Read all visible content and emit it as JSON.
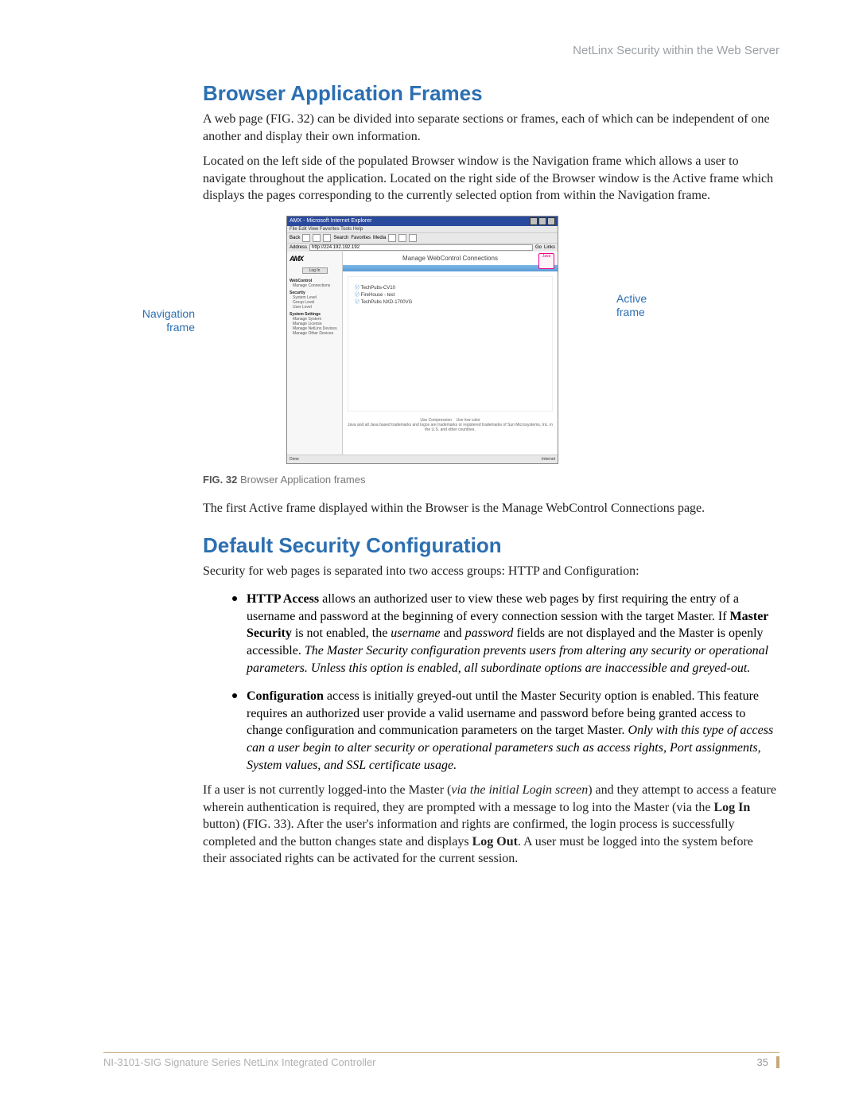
{
  "header_text": "NetLinx Security within the Web Server",
  "section1_title": "Browser Application Frames",
  "para1": "A web page (FIG. 32) can be divided into separate sections or frames, each of which can be independent of one another and display their own information.",
  "para2": "Located on the left side of the populated Browser window is the Navigation frame which allows a user to navigate throughout the application. Located on the right side of the Browser window is the Active frame which displays the pages corresponding to the currently selected option from within the Navigation frame.",
  "nav_label": "Navigation frame",
  "active_label": "Active frame",
  "browser": {
    "title": "AMX - Microsoft Internet Explorer",
    "menus": "File   Edit   View   Favorites   Tools   Help",
    "toolbar_back": "Back",
    "toolbar_search": "Search",
    "toolbar_fav": "Favorites",
    "toolbar_media": "Media",
    "addr_label": "Address",
    "addr_value": "http://224.192.192.192",
    "addr_go": "Go",
    "addr_links": "Links",
    "logo": "AMX",
    "login": "Log In",
    "sidebar": {
      "grp1_hd": "WebControl",
      "grp1_it1": "Manage Connections",
      "grp2_hd": "Security",
      "grp2_it1": "System Level",
      "grp2_it2": "Group Level",
      "grp2_it3": "User Level",
      "grp3_hd": "System Settings",
      "grp3_it1": "Manage System",
      "grp3_it2": "Manage License",
      "grp3_it3": "Manage NetLinx Devices",
      "grp3_it4": "Manage Other Devices"
    },
    "main_title": "Manage WebControl Connections",
    "java_label": "Java",
    "list_row1": "TechPubs-CV10",
    "list_row2": "FireHouse - test",
    "list_row3": "TechPubs NXD-1700VG",
    "foot_compress": "Use Compression",
    "foot_lowcolor": "Use low color",
    "foot_trademark": "Java and all Java based trademarks and logos are trademarks or registered trademarks of Sun Microsystems, Inc. in the U.S. and other countries.",
    "status_done": "Done",
    "status_net": "Internet"
  },
  "fig_caption_bold": "FIG. 32",
  "fig_caption_rest": "  Browser Application frames",
  "para3": "The first Active frame displayed within the Browser is the Manage WebControl Connections page.",
  "section2_title": "Default Security Configuration",
  "para4": "Security for web pages is separated into two access groups: HTTP and Configuration:",
  "bullet1_bold1": "HTTP Access",
  "bullet1_part1": " allows an authorized user to view these web pages by first requiring the entry of a username and password at the beginning of every connection session with the target Master. If ",
  "bullet1_bold2": "Master Security",
  "bullet1_part2": " is not enabled, the ",
  "bullet1_italic1": "username",
  "bullet1_part3": " and ",
  "bullet1_italic2": "password",
  "bullet1_part4": " fields are not displayed and the Master is openly accessible. ",
  "bullet1_italic3": "The Master Security configuration prevents users from altering any security or operational parameters. Unless this option is enabled, all subordinate options are inaccessible and greyed-out.",
  "bullet2_bold1": "Configuration",
  "bullet2_part1": " access is initially greyed-out until the Master Security option is enabled. This feature requires an authorized user provide a valid username and password before being granted access to change configuration and communication parameters on the target Master. ",
  "bullet2_italic1": "Only with this type of access can a user begin to alter security or operational parameters such as access rights, Port assignments, System values, and SSL certificate usage.",
  "para5_1": "If a user is not currently logged-into the Master (",
  "para5_italic": "via the initial Login screen",
  "para5_2": ") and they attempt to access a feature wherein authentication is required, they are prompted with a message to log into the Master (via the ",
  "para5_bold1": "Log In",
  "para5_3": " button) (FIG. 33). After the user's information and rights are confirmed, the login process is successfully completed and the button changes state and displays ",
  "para5_bold2": "Log Out",
  "para5_4": ". A user must be logged into the system before their associated rights can be activated for the current session.",
  "footer_left": "NI-3101-SIG Signature Series NetLinx Integrated Controller",
  "footer_page": "35"
}
